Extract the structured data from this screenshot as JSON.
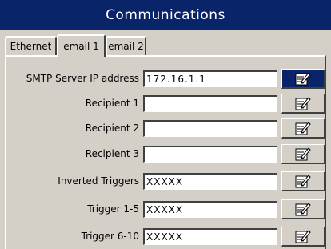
{
  "window": {
    "title": "Communications"
  },
  "tabs": [
    {
      "label": "Ethernet",
      "active": false
    },
    {
      "label": "email 1",
      "active": true
    },
    {
      "label": "email 2",
      "active": false
    }
  ],
  "rows": [
    {
      "label": "SMTP Server IP address",
      "value": "172.16.1.1",
      "selected": true
    },
    {
      "label": "Recipient 1",
      "value": ""
    },
    {
      "label": "Recipient 2",
      "value": ""
    },
    {
      "label": "Recipient 3",
      "value": ""
    },
    {
      "label": "Inverted Triggers",
      "value": "XXXXX"
    },
    {
      "label": "Trigger 1-5",
      "value": "XXXXX"
    },
    {
      "label": "Trigger 6-10",
      "value": "XXXXX"
    }
  ],
  "edit_icon": "edit-pencil-icon",
  "colors": {
    "titlebar": "#0a246a",
    "selected_button": "#0a246a",
    "face": "#d4d0c8"
  }
}
